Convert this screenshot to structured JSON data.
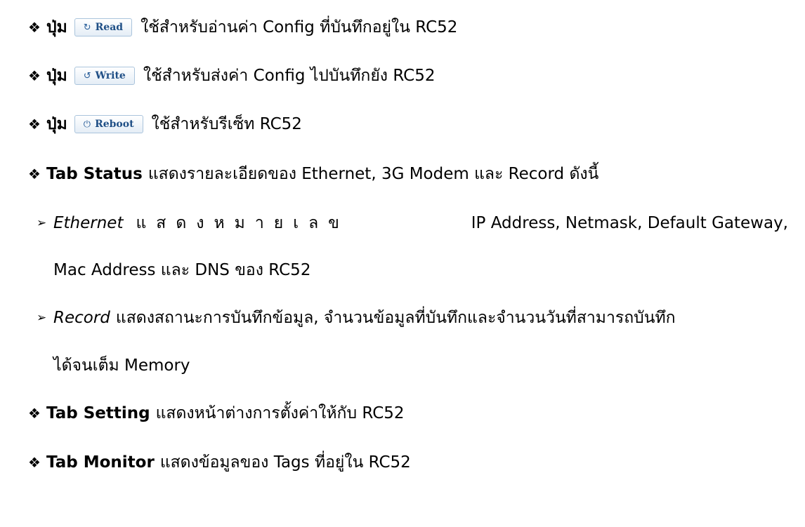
{
  "bullet_symbol": "❖",
  "arrow_symbol": "➢",
  "buttons": [
    {
      "prefix": "ปุ่ม",
      "icon": "↻",
      "label": "Read",
      "desc": "ใช้สำหรับอ่านค่า Config ที่บันทึกอยู่ใน RC52"
    },
    {
      "prefix": "ปุ่ม",
      "icon": "↺",
      "label": "Write",
      "desc": "ใช้สำหรับส่งค่า Config ไปบันทึกยัง RC52"
    },
    {
      "prefix": "ปุ่ม",
      "icon": "⏻",
      "label": "Reboot",
      "desc": "ใช้สำหรับรีเซ็ท RC52"
    }
  ],
  "tab_status": {
    "title": "Tab Status",
    "desc": "แสดงรายละเอียดของ Ethernet, 3G Modem และ Record ดังนี้"
  },
  "ethernet": {
    "title": "Ethernet",
    "spaced": "แสดงหมายเลข",
    "line1_rest": "IP Address, Netmask, Default Gateway,",
    "line2": "Mac Address และ DNS ของ RC52"
  },
  "record": {
    "title": "Record",
    "line1_rest": "แสดงสถานะการบันทึกข้อมูล, จำนวนข้อมูลที่บันทึกและจำนวนวันที่สามารถบันทึก",
    "line2": "ได้จนเต็ม Memory"
  },
  "tab_setting": {
    "title": "Tab Setting",
    "desc": "แสดงหน้าต่างการตั้งค่าให้กับ RC52"
  },
  "tab_monitor": {
    "title": "Tab Monitor",
    "desc": "แสดงข้อมูลของ Tags ที่อยู่ใน RC52"
  }
}
